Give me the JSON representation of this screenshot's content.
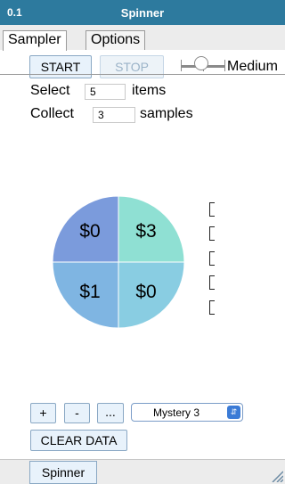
{
  "window": {
    "version": "0.1",
    "title": "Spinner"
  },
  "tabs": [
    {
      "label": "Sampler",
      "active": true
    },
    {
      "label": "Options",
      "active": false
    }
  ],
  "controls": {
    "start_label": "START",
    "stop_label": "STOP",
    "speed_label": "Medium",
    "select_prefix": "Select",
    "select_value": "5",
    "select_suffix": "items",
    "collect_prefix": "Collect",
    "collect_value": "3",
    "collect_suffix": "samples"
  },
  "spinner": {
    "sections": [
      {
        "label": "$0",
        "color": "#7b9bdc"
      },
      {
        "label": "$3",
        "color": "#8fe0d3"
      },
      {
        "label": "$0",
        "color": "#89cde2"
      },
      {
        "label": "$1",
        "color": "#7fb5e2"
      }
    ]
  },
  "toolbar": {
    "add_label": "+",
    "remove_label": "-",
    "more_label": "...",
    "preset_value": "Mystery 3",
    "clear_label": "CLEAR DATA"
  },
  "bottom": {
    "tab_label": "Spinner"
  },
  "colors": {
    "titlebar": "#2d7a9e",
    "button": "#e8f2fb"
  }
}
